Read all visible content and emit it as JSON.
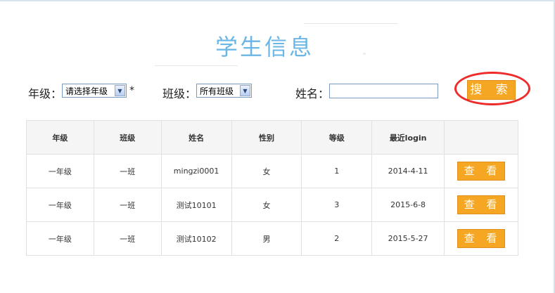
{
  "title": "学生信息",
  "filters": {
    "grade_label": "年级：",
    "grade_value": "请选择年级",
    "required_mark": "*",
    "class_label": "班级：",
    "class_value": "所有班级",
    "name_label": "姓名：",
    "name_value": "",
    "search_label": "搜 索"
  },
  "table": {
    "headers": [
      "年级",
      "班级",
      "姓名",
      "性别",
      "等级",
      "最近login",
      ""
    ],
    "rows": [
      {
        "grade": "一年级",
        "class": "一班",
        "name": "mingzi0001",
        "gender": "女",
        "level": "1",
        "last_login": "2014-4-11",
        "action": "查 看"
      },
      {
        "grade": "一年级",
        "class": "一班",
        "name": "测试10101",
        "gender": "女",
        "level": "3",
        "last_login": "2015-6-8",
        "action": "查 看"
      },
      {
        "grade": "一年级",
        "class": "一班",
        "name": "测试10102",
        "gender": "男",
        "level": "2",
        "last_login": "2015-5-27",
        "action": "查 看"
      }
    ]
  },
  "colors": {
    "title": "#6ab6e6",
    "button": "#f5a623",
    "annotation_circle": "#ee2a2a"
  }
}
